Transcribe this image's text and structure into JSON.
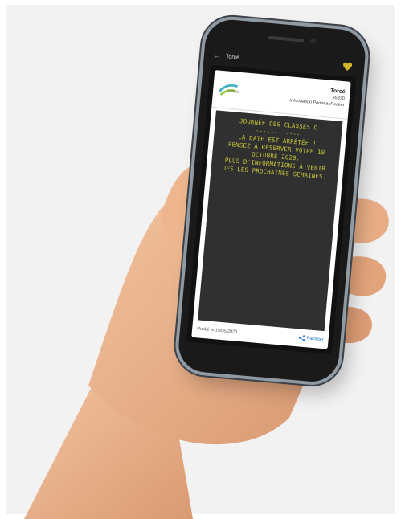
{
  "app": {
    "title": "Torcé",
    "back_icon": "back-arrow-icon",
    "favorite_icon": "heart-icon",
    "accent": "#d4b62c"
  },
  "card": {
    "commune": "Torcé",
    "code": "35370",
    "source": "Information PanneauPocket",
    "logo_text": "TORCÉ",
    "board": {
      "text_color": "#c9c637",
      "background": "#303030",
      "lines": [
        "JOURNÉE DES CLASSES O",
        "------------",
        "",
        "LA DATE EST ARRÊTÉE !",
        "PENSEZ À RÉSERVER VOTRE 10",
        "OCTOBRE 2020.",
        "PLUS D'INFORMATIONS À VENIR",
        "DES LES PROCHAINES SEMAINES."
      ]
    },
    "published": "Publié le 15/05/2020",
    "share_label": "Partager",
    "share_icon": "share-icon"
  }
}
